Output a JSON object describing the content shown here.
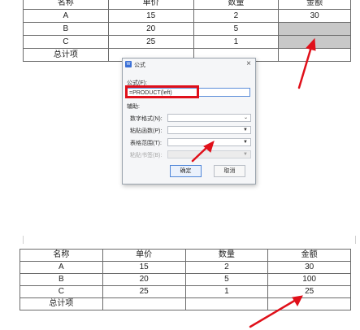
{
  "top_table": {
    "headers": [
      "名称",
      "单价",
      "数量",
      "金额"
    ],
    "rows": [
      [
        "A",
        "15",
        "2",
        "30"
      ],
      [
        "B",
        "20",
        "5",
        ""
      ],
      [
        "C",
        "25",
        "1",
        ""
      ],
      [
        "总计项",
        "",
        "",
        ""
      ]
    ]
  },
  "dialog": {
    "title": "公式",
    "close_label": "×",
    "formula_label": "公式(F):",
    "formula_value": "=PRODUCT(left)",
    "helper_label": "辅助:",
    "number_format_label": "数字格式(N):",
    "paste_function_label": "粘贴函数(P):",
    "table_range_label": "表格范围(T):",
    "paste_bookmark_label": "粘贴书签(B):",
    "ok_label": "确定",
    "cancel_label": "取消"
  },
  "bottom_table": {
    "headers": [
      "名称",
      "单价",
      "数量",
      "金额"
    ],
    "rows": [
      [
        "A",
        "15",
        "2",
        "30"
      ],
      [
        "B",
        "20",
        "5",
        "100"
      ],
      [
        "C",
        "25",
        "1",
        "25"
      ],
      [
        "总计项",
        "",
        "",
        ""
      ]
    ]
  },
  "colors": {
    "annotation_red": "#e0101a",
    "shade_gray": "#c8c8c8",
    "focus_blue": "#5b8dd9"
  }
}
